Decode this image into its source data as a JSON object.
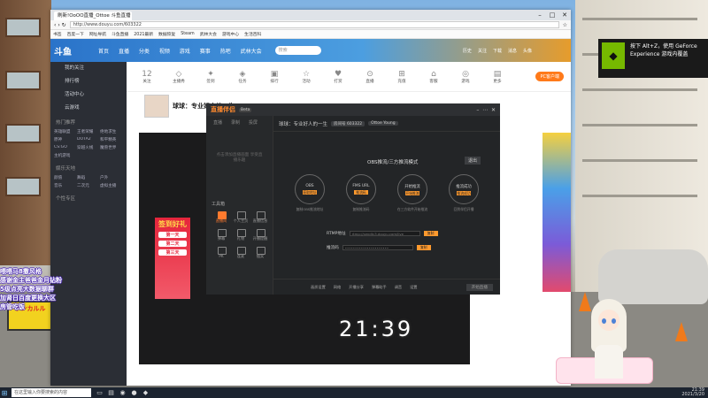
{
  "nvidia": {
    "line1": "按下 Alt+Z，使用 GeForce",
    "line2": "Experience 游戏内覆盖"
  },
  "clock": "21:39",
  "danmu": [
    "喂喂马8撒风格",
    "感谢金主爸爸金月钻粉",
    "5级点亮大数据聊群",
    "加肾日百度更换大区",
    "房管吃饭"
  ],
  "sign_text": "ポンカルル",
  "browser": {
    "tab": "刷新!OoOO直播_Ottoe 斗鱼直播",
    "url": "http://www.douyu.com/603322",
    "bookmarks": [
      "书签",
      "百度一下",
      "网址导航",
      "斗鱼直播",
      "2021最新",
      "数据恢复",
      "Steam",
      "武林大会",
      "游戏中心",
      "生活百科"
    ],
    "nav": [
      "首页",
      "直播",
      "分类",
      "视频",
      "游戏",
      "赛事",
      "热吧",
      "武林大会"
    ],
    "search_placeholder": "搜索",
    "top_icons": [
      "历史",
      "关注",
      "下载",
      "消息",
      "头像"
    ],
    "sidebar": {
      "items": [
        "我的关注",
        "排行榜",
        "活动中心",
        "云游戏"
      ],
      "recommend": "热门推荐",
      "grid": [
        "英雄联盟",
        "王者荣耀",
        "绝地求生",
        "原神",
        "DOTA2",
        "和平精英",
        "CS:GO",
        "穿越火线",
        "魔兽世界",
        "主机游戏"
      ],
      "section2": "娱乐天地",
      "grid2": [
        "颜值",
        "舞蹈",
        "户外",
        "音乐",
        "二次元",
        "虚拟主播"
      ],
      "section3": "个性专区"
    },
    "quick": [
      {
        "n": "12",
        "l": "关注"
      },
      {
        "n": "◇",
        "l": "主播秀"
      },
      {
        "n": "✦",
        "l": "签到"
      },
      {
        "n": "◈",
        "l": "任务"
      },
      {
        "n": "▣",
        "l": "排行"
      },
      {
        "n": "☆",
        "l": "活动"
      },
      {
        "n": "♥",
        "l": "打赏"
      },
      {
        "n": "⊙",
        "l": "直播"
      },
      {
        "n": "⊞",
        "l": "充值"
      },
      {
        "n": "⌂",
        "l": "客服"
      },
      {
        "n": "◎",
        "l": "游戏"
      },
      {
        "n": "▤",
        "l": "更多"
      }
    ],
    "pc_client": "PC客户端",
    "room_title": "球球：专业好人的一生",
    "ad_title": "签到好礼",
    "ad_items": [
      "第一天",
      "第二天",
      "第三天"
    ]
  },
  "dialog": {
    "brand": "直播伴侣",
    "version": "Beta",
    "left_tabs": [
      "直播",
      "录制",
      "投屏"
    ],
    "hint": "点击添加直播画面 享受直播乐趣",
    "tools_header": "工具箱",
    "tools": [
      "直播间",
      "个人主页",
      "直播信息",
      "弹幕",
      "礼物",
      "开播提醒",
      "PK",
      "连麦",
      "抽奖",
      "公告"
    ],
    "room_info": "球球：专业好人的一生",
    "room_meta": "房间号 603322",
    "tag": "Ottoe Young",
    "mode": "OBS推流/三方推流模式",
    "close": "退出",
    "circles": [
      {
        "title": "OBS",
        "btn": "获取地址",
        "cap": "复制OBS推流地址"
      },
      {
        "title": "FMS URL",
        "btn": "推流码",
        "cap": "复制推流码"
      },
      {
        "title": "开始推流",
        "btn": "开始推流",
        "cap": "在三方软件开始推流"
      },
      {
        "title": "推流成功",
        "btn": "推流成功",
        "cap": "回到伴侣开播"
      }
    ],
    "rtmp_label": "RTMP地址",
    "rtmp_val": "rtmp://sendtc3.douyu.com/live",
    "key_label": "推流码",
    "key_val": "••••••••••••••••••••••",
    "copy": "复制",
    "bottom": [
      "画质设置",
      "网络",
      "开播分享",
      "弹幕助手",
      "调音",
      "设置"
    ],
    "start": "开始直播"
  },
  "taskbar": {
    "search": "在这里输入你要搜索的内容",
    "time": "21:39",
    "date": "2021/3/20"
  }
}
